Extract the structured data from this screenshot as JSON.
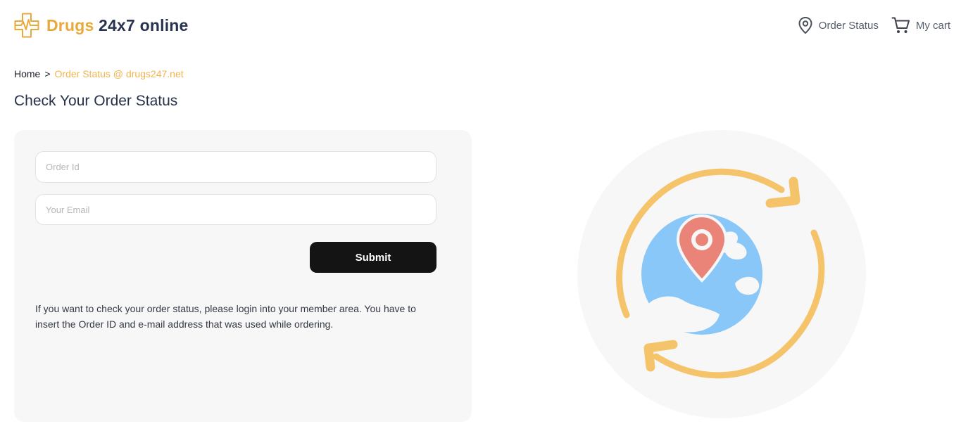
{
  "header": {
    "logo": {
      "word1": "Drugs",
      "word2": "24x7 online",
      "icon": "medical-cross-pulse-icon",
      "brand_color": "#e9a93a",
      "text_color": "#283350"
    },
    "nav": {
      "order_status": {
        "label": "Order Status",
        "icon": "map-pin-icon"
      },
      "cart": {
        "label": "My cart",
        "icon": "shopping-cart-icon"
      }
    }
  },
  "breadcrumb": {
    "home": "Home",
    "separator": ">",
    "current": "Order Status @ drugs247.net"
  },
  "page_title": "Check Your Order Status",
  "form": {
    "order_id": {
      "placeholder": "Order Id",
      "value": ""
    },
    "email": {
      "placeholder": "Your Email",
      "value": ""
    },
    "submit_label": "Submit",
    "info_text": "If you want to check your order status, please login into your member area. You have to insert the Order ID and e-mail address that was used while ordering."
  },
  "illustration": {
    "icon": "globe-location-refresh-icon",
    "colors": {
      "arrows": "#f5c46a",
      "globe": "#88c7f7",
      "pin": "#ea8478",
      "background": "#f7f7f7"
    }
  }
}
